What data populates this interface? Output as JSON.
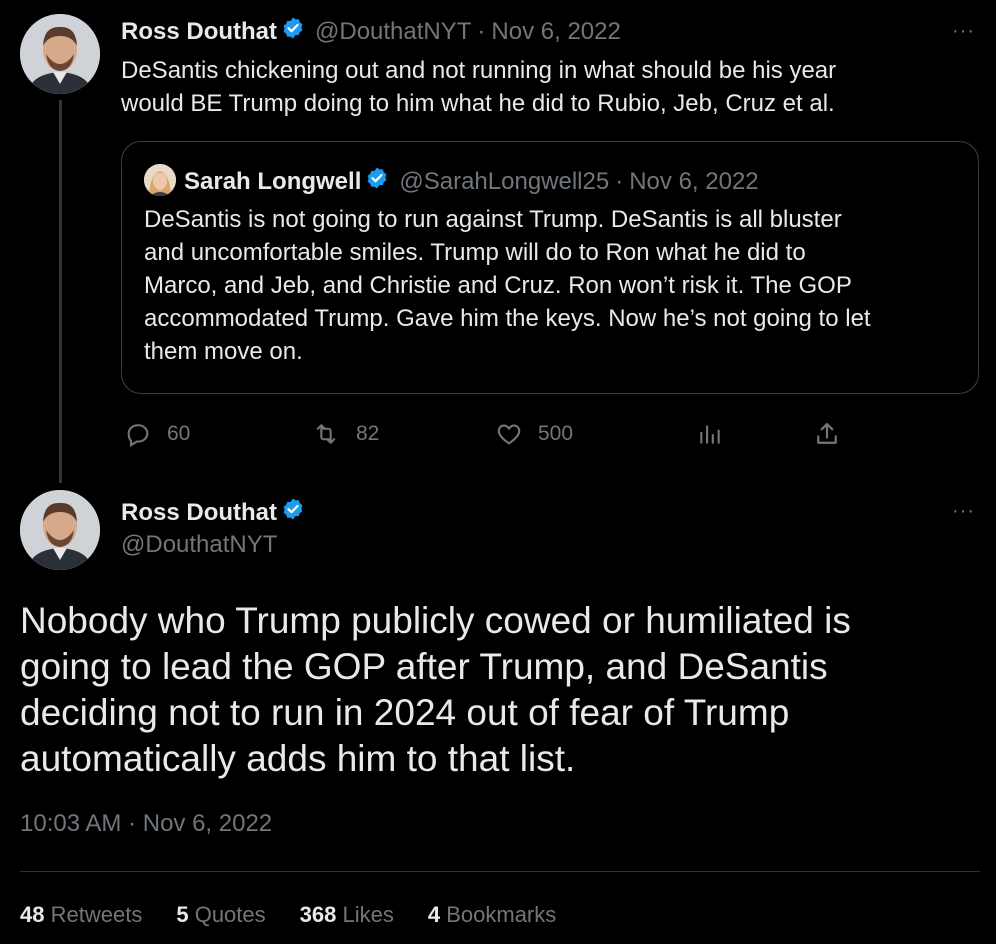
{
  "parent_tweet": {
    "author_name": "Ross Douthat",
    "handle": "@DouthatNYT",
    "date": "Nov 6, 2022",
    "text_line1": "DeSantis chickening out and not running in what should be his year",
    "text_line2": "would BE Trump doing to him what he did to Rubio, Jeb, Cruz et al.",
    "quote": {
      "author_name": "Sarah Longwell",
      "handle": "@SarahLongwell25",
      "date": "Nov 6, 2022",
      "lines": [
        "DeSantis is not going to run against Trump. DeSantis is all bluster",
        "and uncomfortable smiles. Trump will do to Ron what he did to",
        "Marco, and Jeb, and Christie and Cruz. Ron won’t risk it. The GOP",
        "accommodated Trump. Gave him the keys. Now he’s not going to let",
        "them move on."
      ]
    },
    "actions": {
      "replies": "60",
      "retweets": "82",
      "likes": "500"
    }
  },
  "main_tweet": {
    "author_name": "Ross Douthat",
    "handle": "@DouthatNYT",
    "lines": [
      "Nobody who Trump publicly cowed or humiliated is",
      "going to lead the GOP after Trump, and DeSantis",
      "deciding not to run in 2024 out of fear of Trump",
      "automatically adds him to that list."
    ],
    "timestamp": "10:03 AM · Nov 6, 2022",
    "stats": [
      {
        "count": "48",
        "label": "Retweets"
      },
      {
        "count": "5",
        "label": "Quotes"
      },
      {
        "count": "368",
        "label": "Likes"
      },
      {
        "count": "4",
        "label": "Bookmarks"
      }
    ]
  },
  "ui": {
    "more_glyph": "···",
    "separator": "·"
  },
  "colors": {
    "background": "#000000",
    "text": "#e7e9ea",
    "muted": "#71767b",
    "verified": "#1d9bf0",
    "border": "#2f3336"
  }
}
